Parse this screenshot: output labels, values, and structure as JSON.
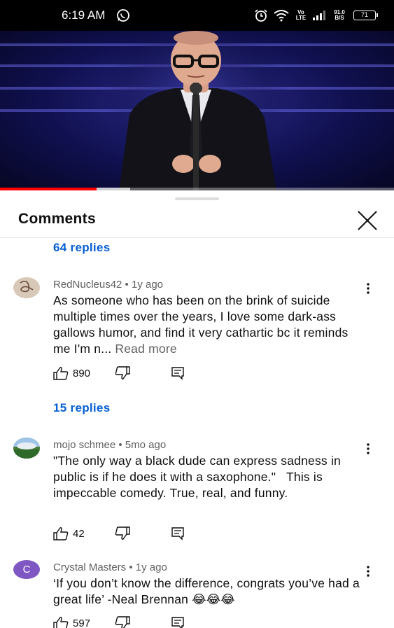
{
  "status_bar": {
    "time": "6:19 AM",
    "volte": "Vo LTE",
    "speed": "91.0 B/S",
    "battery": "71"
  },
  "player": {
    "progress_fraction": 0.245,
    "buffer_fraction": 0.33
  },
  "panel": {
    "title": "Comments",
    "top_replies": "64 replies"
  },
  "comments": [
    {
      "author_meta": "RedNucleus42 • 1y ago",
      "text": "As someone who has been on the brink of suicide multiple times over the years, I love some dark-ass gallows humor, and find it very cathartic bc it reminds me I'm n...",
      "read_more": "Read more",
      "likes": "890",
      "replies": "15 replies"
    },
    {
      "author_meta": "mojo schmee • 5mo ago",
      "text": "\"The only way a black dude can express sadness in public is if he does it with a saxophone.\"   This is impeccable comedy. True, real, and funny.",
      "likes": "42"
    },
    {
      "author_meta": "Crystal Masters • 1y ago",
      "avatar_letter": "C",
      "text": "‘If you don’t know the difference, congrats you’ve had a great life’ -Neal Brennan 😂😂😂",
      "likes": "597"
    }
  ],
  "colors": {
    "link_blue": "#065fd4",
    "avatar_purple": "#7e57c2",
    "progress_red": "#ff0000"
  }
}
